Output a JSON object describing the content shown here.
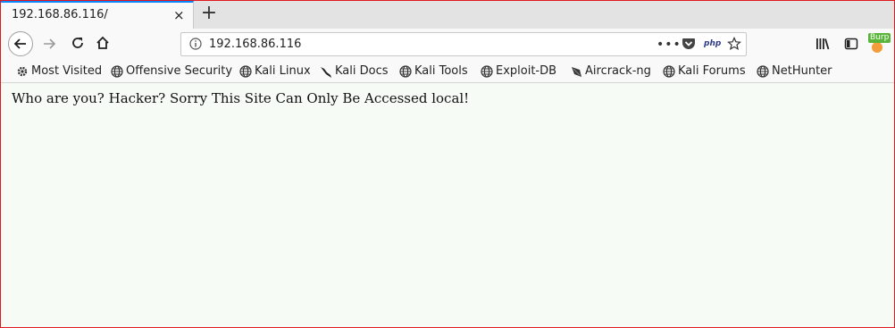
{
  "tab": {
    "title": "192.168.86.116/",
    "close_glyph": "×",
    "new_tab_glyph": "+"
  },
  "navbar": {
    "url": "192.168.86.116",
    "page_actions_glyph": "•••",
    "php_label": "php",
    "burp_badge": "Burp"
  },
  "bookmarks": [
    {
      "label": "Most Visited",
      "icon": "gear-icon"
    },
    {
      "label": "Offensive Security",
      "icon": "globe-icon"
    },
    {
      "label": "Kali Linux",
      "icon": "globe-icon"
    },
    {
      "label": "Kali Docs",
      "icon": "kali-dragon-icon"
    },
    {
      "label": "Kali Tools",
      "icon": "globe-icon"
    },
    {
      "label": "Exploit-DB",
      "icon": "globe-icon"
    },
    {
      "label": "Aircrack-ng",
      "icon": "aircrack-icon"
    },
    {
      "label": "Kali Forums",
      "icon": "globe-icon"
    },
    {
      "label": "NetHunter",
      "icon": "globe-icon"
    }
  ],
  "page": {
    "message": "Who are you? Hacker? Sorry This Site Can Only Be Accessed local!"
  },
  "colors": {
    "frame_border": "#e0191f",
    "content_bg": "#f6fbf6",
    "tab_accent": "#0a84ff"
  }
}
